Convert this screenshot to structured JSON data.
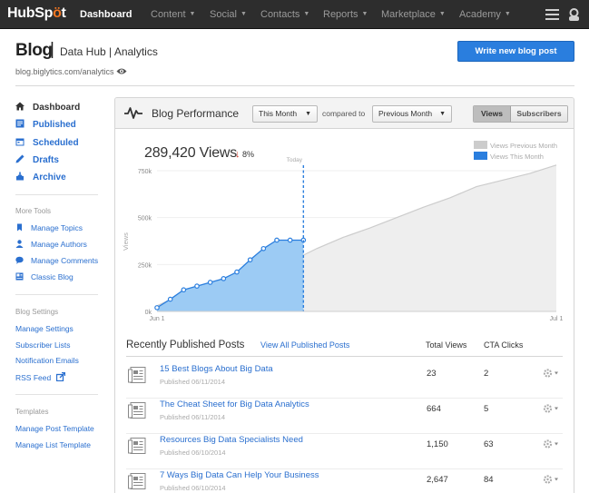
{
  "app": {
    "logo_a": "HubSp",
    "logo_b": "t",
    "nav": [
      "Dashboard",
      "Content",
      "Social",
      "Contacts",
      "Reports",
      "Marketplace",
      "Academy"
    ]
  },
  "header": {
    "title": "Blog",
    "separator": "|",
    "blog_name": "Data Hub | Analytics",
    "url": "blog.biglytics.com/analytics",
    "write_button": "Write new blog post"
  },
  "sidebar": {
    "main": [
      {
        "label": "Dashboard",
        "icon": "home-icon"
      },
      {
        "label": "Published",
        "icon": "document-icon"
      },
      {
        "label": "Scheduled",
        "icon": "calendar-icon"
      },
      {
        "label": "Drafts",
        "icon": "pencil-icon"
      },
      {
        "label": "Archive",
        "icon": "archive-icon"
      }
    ],
    "more_tools_label": "More Tools",
    "more_tools": [
      {
        "label": "Manage Topics",
        "icon": "bookmark-icon"
      },
      {
        "label": "Manage Authors",
        "icon": "person-icon"
      },
      {
        "label": "Manage Comments",
        "icon": "speech-bubble-icon"
      },
      {
        "label": "Classic Blog",
        "icon": "layout-icon"
      }
    ],
    "settings_label": "Blog Settings",
    "settings": [
      "Manage Settings",
      "Subscriber Lists",
      "Notification Emails",
      "RSS Feed"
    ],
    "templates_label": "Templates",
    "templates": [
      "Manage Post Template",
      "Manage List Template"
    ]
  },
  "panel": {
    "title": "Blog Performance",
    "period_select": "This Month",
    "compared_to": "compared to",
    "compare_select": "Previous Month",
    "toggle": [
      "Views",
      "Subscribers"
    ],
    "active_toggle": "Views",
    "total_views": "289,420 Views",
    "change_arrow": "↓",
    "change": "8%",
    "colors": {
      "this_month": "#2a7ede",
      "this_month_fill": "#9ccbf4",
      "previous_month": "#cccccc",
      "previous_month_fill": "#eeeeee",
      "today_line": "#2a7ede"
    }
  },
  "chart_data": {
    "type": "area",
    "title": "",
    "ylabel": "Views",
    "xlabel": "",
    "x_tick_labels": [
      "Jun 1",
      "Jul 1"
    ],
    "y_tick_labels": [
      "0k",
      "250k",
      "500k",
      "750k"
    ],
    "ylim": [
      0,
      750000
    ],
    "annotation": "Today",
    "legend_placement": "top-right",
    "grid": true,
    "series": [
      {
        "name": "Views Previous Month",
        "x": [
          1,
          3,
          5,
          7,
          9,
          11,
          13,
          15,
          17,
          19,
          21,
          23,
          25,
          27,
          29,
          31
        ],
        "values": [
          30000,
          95000,
          145000,
          175000,
          215000,
          265000,
          335000,
          395000,
          445000,
          500000,
          555000,
          605000,
          665000,
          700000,
          735000,
          780000
        ]
      },
      {
        "name": "Views This Month",
        "x": [
          1,
          2,
          3,
          4,
          5,
          6,
          7,
          8,
          9,
          10,
          11,
          12
        ],
        "values": [
          20000,
          65000,
          115000,
          135000,
          155000,
          175000,
          210000,
          275000,
          335000,
          380000,
          380000,
          380000
        ]
      }
    ],
    "today_x": 12
  },
  "posts": {
    "section_title": "Recently Published Posts",
    "view_all": "View All Published Posts",
    "col_views": "Total Views",
    "col_cta": "CTA Clicks",
    "rows": [
      {
        "title": "15 Best Blogs About Big Data",
        "date": "Published 06/11/2014",
        "views": "23",
        "cta": "2"
      },
      {
        "title": "The Cheat Sheet for Big Data Analytics",
        "date": "Published 06/11/2014",
        "views": "664",
        "cta": "5"
      },
      {
        "title": "Resources Big Data Specialists Need",
        "date": "Published 06/10/2014",
        "views": "1,150",
        "cta": "63"
      },
      {
        "title": "7 Ways Big Data Can Help Your Business",
        "date": "Published 06/10/2014",
        "views": "2,647",
        "cta": "84"
      }
    ]
  }
}
